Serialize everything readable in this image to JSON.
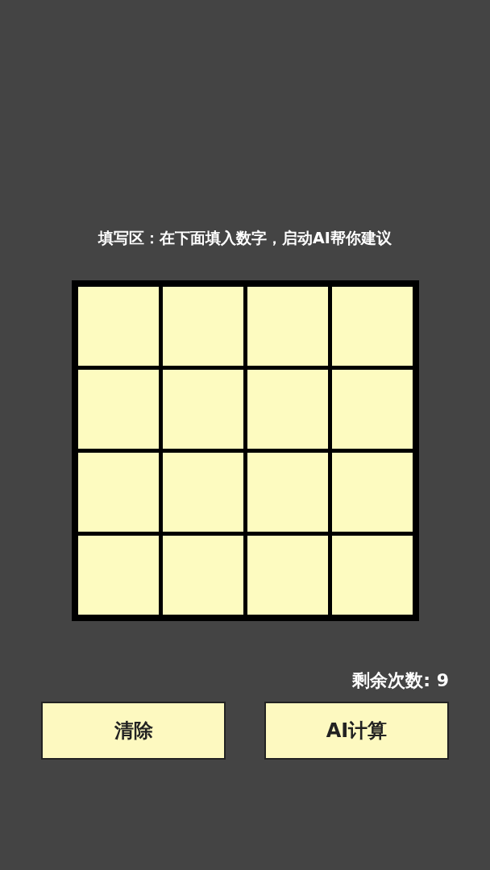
{
  "prompt": "填写区：在下面填入数字，启动AI帮你建议",
  "grid": {
    "rows": [
      {
        "cells": [
          {
            "kind": "input"
          },
          {
            "kind": "input"
          },
          {
            "kind": "input"
          },
          {
            "kind": "input"
          }
        ]
      },
      {
        "cells": [
          {
            "kind": "input"
          },
          {
            "kind": "input"
          },
          {
            "kind": "input"
          },
          {
            "kind": "input"
          }
        ]
      },
      {
        "cells": [
          {
            "kind": "input"
          },
          {
            "kind": "input"
          },
          {
            "kind": "input"
          },
          {
            "kind": "input"
          }
        ]
      },
      {
        "cells": [
          {
            "kind": "input"
          },
          {
            "kind": "input"
          },
          {
            "kind": "input"
          },
          {
            "kind": "input"
          }
        ]
      }
    ]
  },
  "remaining": "剩余次数: 9",
  "buttons": [
    {
      "label": "清除"
    },
    {
      "label": "AI计算"
    }
  ]
}
